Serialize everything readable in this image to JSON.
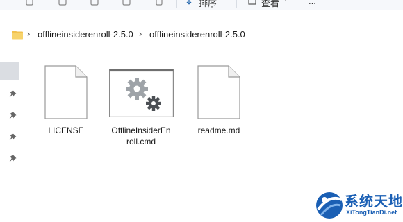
{
  "toolbar": {
    "sort_label": "排序",
    "view_label": "查看",
    "more_label": "..."
  },
  "address": {
    "crumbs": [
      "offlineinsiderenroll-2.5.0",
      "offlineinsiderenroll-2.5.0"
    ]
  },
  "files": [
    {
      "name": "LICENSE",
      "icon": "document-icon"
    },
    {
      "name_line1": "OfflineInsiderEn",
      "name_line2": "roll.cmd",
      "icon": "cmd-script-icon"
    },
    {
      "name": "readme.md",
      "icon": "document-icon"
    }
  ],
  "watermark": {
    "title": "系统天地",
    "subtitle": "XiTongTianDi.net"
  },
  "colors": {
    "selection": "#dadde2",
    "folder": "#f2c14e",
    "watermark": "#1a5fb4"
  }
}
